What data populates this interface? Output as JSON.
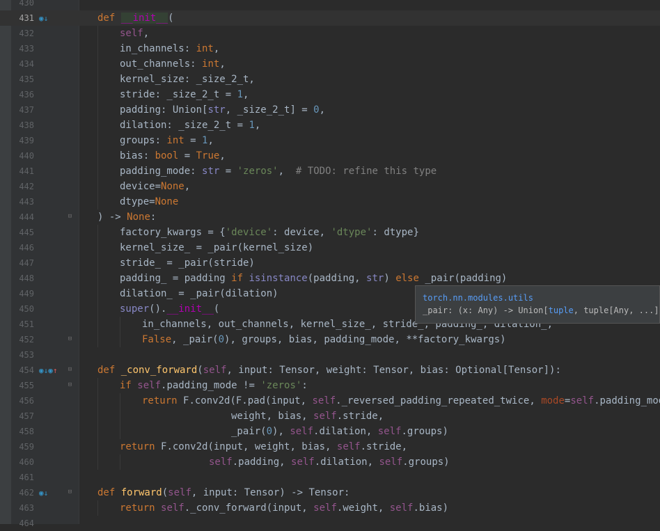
{
  "lines": [
    {
      "num": "430",
      "code": []
    },
    {
      "num": "431",
      "indent": 0,
      "current": true,
      "marks": [
        {
          "icon": "implements-icon",
          "glyph": "◉"
        },
        {
          "icon": "overridden-down-icon",
          "glyph": "↓"
        }
      ],
      "code": [
        [
          "kw",
          "def "
        ],
        [
          "dunder hl",
          "__init__"
        ],
        [
          "",
          "("
        ]
      ]
    },
    {
      "num": "432",
      "indent": 1,
      "code": [
        [
          "self",
          "self"
        ],
        [
          "",
          ","
        ]
      ]
    },
    {
      "num": "433",
      "indent": 1,
      "code": [
        [
          "",
          "in_channels: "
        ],
        [
          "kw",
          "int"
        ],
        [
          "",
          ","
        ]
      ]
    },
    {
      "num": "434",
      "indent": 1,
      "code": [
        [
          "",
          "out_channels: "
        ],
        [
          "kw",
          "int"
        ],
        [
          "",
          ","
        ]
      ]
    },
    {
      "num": "435",
      "indent": 1,
      "code": [
        [
          "",
          "kernel_size: _size_2_t,"
        ]
      ]
    },
    {
      "num": "436",
      "indent": 1,
      "code": [
        [
          "",
          "stride: _size_2_t = "
        ],
        [
          "num",
          "1"
        ],
        [
          "",
          ","
        ]
      ]
    },
    {
      "num": "437",
      "indent": 1,
      "code": [
        [
          "",
          "padding: Union["
        ],
        [
          "bi",
          "str"
        ],
        [
          "",
          ", _size_2_t] = "
        ],
        [
          "num",
          "0"
        ],
        [
          "",
          ","
        ]
      ]
    },
    {
      "num": "438",
      "indent": 1,
      "code": [
        [
          "",
          "dilation: _size_2_t = "
        ],
        [
          "num",
          "1"
        ],
        [
          "",
          ","
        ]
      ]
    },
    {
      "num": "439",
      "indent": 1,
      "code": [
        [
          "",
          "groups: "
        ],
        [
          "kw",
          "int"
        ],
        [
          "",
          " = "
        ],
        [
          "num",
          "1"
        ],
        [
          "",
          ","
        ]
      ]
    },
    {
      "num": "440",
      "indent": 1,
      "code": [
        [
          "",
          "bias: "
        ],
        [
          "kw",
          "bool"
        ],
        [
          "",
          "",
          " = "
        ],
        [
          "",
          " = "
        ],
        [
          "kw",
          "True"
        ],
        [
          "",
          ","
        ]
      ]
    },
    {
      "num": "441",
      "indent": 1,
      "code": [
        [
          "",
          "padding_mode: "
        ],
        [
          "bi",
          "str"
        ],
        [
          "",
          " = "
        ],
        [
          "str",
          "'zeros'"
        ],
        [
          "",
          ",  "
        ],
        [
          "cmt",
          "# TODO: refine this type"
        ]
      ]
    },
    {
      "num": "442",
      "indent": 1,
      "code": [
        [
          "",
          "device="
        ],
        [
          "kw",
          "None"
        ],
        [
          "",
          ","
        ]
      ]
    },
    {
      "num": "443",
      "indent": 1,
      "code": [
        [
          "",
          "dtype="
        ],
        [
          "kw",
          "None"
        ]
      ]
    },
    {
      "num": "444",
      "indent": 0,
      "fold": "end",
      "code": [
        [
          "",
          ") -> "
        ],
        [
          "kw",
          "None"
        ],
        [
          "",
          ":"
        ]
      ]
    },
    {
      "num": "445",
      "indent": 1,
      "code": [
        [
          "",
          "factory_kwargs = {"
        ],
        [
          "str",
          "'device'"
        ],
        [
          "",
          ": device, "
        ],
        [
          "str",
          "'dtype'"
        ],
        [
          "",
          ": dtype}"
        ]
      ]
    },
    {
      "num": "446",
      "indent": 1,
      "code": [
        [
          "",
          "kernel_size_ = _pair(kernel_size)"
        ]
      ]
    },
    {
      "num": "447",
      "indent": 1,
      "code": [
        [
          "",
          "stride_ = _pair(stride)"
        ]
      ]
    },
    {
      "num": "448",
      "indent": 1,
      "code": [
        [
          "",
          "padding_ = padding "
        ],
        [
          "kw",
          "if "
        ],
        [
          "bi",
          "isinstance"
        ],
        [
          "",
          "(padding, "
        ],
        [
          "bi",
          "str"
        ],
        [
          "",
          ") "
        ],
        [
          "kw",
          "else "
        ],
        [
          "",
          "_pair(padding)"
        ]
      ]
    },
    {
      "num": "449",
      "indent": 1,
      "code": [
        [
          "",
          "dilation_ = _pair(dilation)"
        ]
      ]
    },
    {
      "num": "450",
      "indent": 1,
      "code": [
        [
          "bi",
          "super"
        ],
        [
          "",
          "()."
        ],
        [
          "dunder",
          "__init__"
        ],
        [
          "",
          "("
        ]
      ]
    },
    {
      "num": "451",
      "indent": 2,
      "code": [
        [
          "",
          "in_channels, out_channels, kernel_size_, stride_, padding_, dilation_,"
        ]
      ]
    },
    {
      "num": "452",
      "indent": 2,
      "fold": "end",
      "code": [
        [
          "kw",
          "False"
        ],
        [
          "",
          ", _pair("
        ],
        [
          "num",
          "0"
        ],
        [
          "",
          "), groups, bias, padding_mode, **factory_kwargs)"
        ]
      ]
    },
    {
      "num": "453",
      "code": []
    },
    {
      "num": "454",
      "indent": 0,
      "fold": "start",
      "marks": [
        {
          "icon": "implements-icon",
          "glyph": "◉"
        },
        {
          "icon": "overridden-down-icon",
          "glyph": "↓"
        },
        {
          "icon": "implements-icon",
          "glyph": "◉"
        },
        {
          "icon": "overrides-up-icon",
          "glyph": "↑"
        }
      ],
      "code": [
        [
          "kw",
          "def "
        ],
        [
          "fn",
          "_conv_forward"
        ],
        [
          "",
          "("
        ],
        [
          "self",
          "self"
        ],
        [
          "",
          ", input: Tensor, weight: Tensor, bias: Optional[Tensor]):"
        ]
      ]
    },
    {
      "num": "455",
      "indent": 1,
      "fold": "start",
      "code": [
        [
          "kw",
          "if "
        ],
        [
          "self",
          "self"
        ],
        [
          "",
          ".padding_mode != "
        ],
        [
          "str",
          "'zeros'"
        ],
        [
          "",
          ":"
        ]
      ]
    },
    {
      "num": "456",
      "indent": 2,
      "code": [
        [
          "kw",
          "return "
        ],
        [
          "",
          "F.conv2d(F.pad(input, "
        ],
        [
          "self",
          "self"
        ],
        [
          "",
          "._reversed_padding_repeated_twice, "
        ],
        [
          "param",
          "mode"
        ],
        [
          "",
          "="
        ],
        [
          "self",
          "self"
        ],
        [
          "",
          ".padding_mode),"
        ]
      ]
    },
    {
      "num": "457",
      "indent": 6,
      "code": [
        [
          "",
          "weight, bias, "
        ],
        [
          "self",
          "self"
        ],
        [
          "",
          ".stride,"
        ]
      ]
    },
    {
      "num": "458",
      "indent": 6,
      "code": [
        [
          "",
          "_pair("
        ],
        [
          "num",
          "0"
        ],
        [
          "",
          "), "
        ],
        [
          "self",
          "self"
        ],
        [
          "",
          ".dilation, "
        ],
        [
          "self",
          "self"
        ],
        [
          "",
          ".groups)"
        ]
      ]
    },
    {
      "num": "459",
      "indent": 1,
      "code": [
        [
          "kw",
          "return "
        ],
        [
          "",
          "F.conv2d(input, weight, bias, "
        ],
        [
          "self",
          "self"
        ],
        [
          "",
          ".stride,"
        ]
      ]
    },
    {
      "num": "460",
      "indent": 5,
      "code": [
        [
          "self",
          "self"
        ],
        [
          "",
          ".padding, "
        ],
        [
          "self",
          "self"
        ],
        [
          "",
          ".dilation, "
        ],
        [
          "self",
          "self"
        ],
        [
          "",
          ".groups)"
        ]
      ]
    },
    {
      "num": "461",
      "code": []
    },
    {
      "num": "462",
      "indent": 0,
      "fold": "start",
      "marks": [
        {
          "icon": "implements-icon",
          "glyph": "◉"
        },
        {
          "icon": "overridden-down-icon",
          "glyph": "↓"
        }
      ],
      "code": [
        [
          "kw",
          "def "
        ],
        [
          "fn",
          "forward"
        ],
        [
          "",
          "("
        ],
        [
          "self",
          "self"
        ],
        [
          "",
          ", input: Tensor) -> Tensor:"
        ]
      ]
    },
    {
      "num": "463",
      "indent": 1,
      "code": [
        [
          "kw",
          "return "
        ],
        [
          "self",
          "self"
        ],
        [
          "",
          "._conv_forward(input, "
        ],
        [
          "self",
          "self"
        ],
        [
          "",
          ".weight, "
        ],
        [
          "self",
          "self"
        ],
        [
          "",
          ".bias)"
        ]
      ]
    },
    {
      "num": "464",
      "code": []
    }
  ],
  "tooltip": {
    "module": "torch.nn.modules.utils",
    "signature_prefix": "_pair: (x: Any) -> Union[",
    "signature_type": "tuple",
    "signature_suffix": ", tuple[Any, ...]]"
  }
}
